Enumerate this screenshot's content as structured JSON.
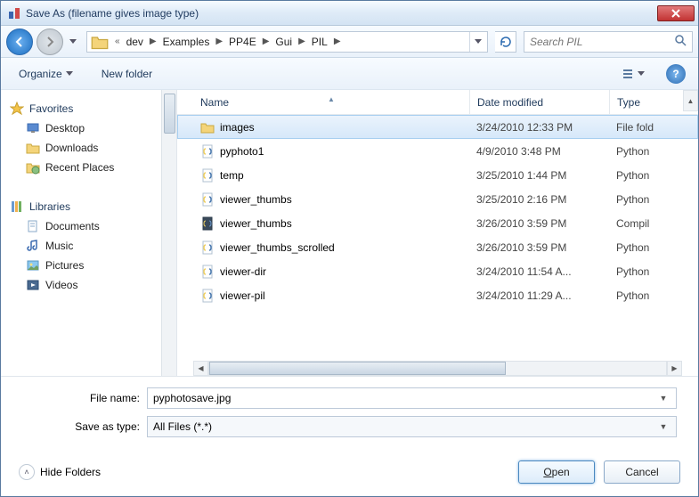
{
  "window": {
    "title": "Save As (filename gives image type)"
  },
  "breadcrumb": {
    "items": [
      "dev",
      "Examples",
      "PP4E",
      "Gui",
      "PIL"
    ]
  },
  "search": {
    "placeholder": "Search PIL"
  },
  "toolbar": {
    "organize": "Organize",
    "newfolder": "New folder"
  },
  "sidebar": {
    "fav_head": "Favorites",
    "fav_items": [
      "Desktop",
      "Downloads",
      "Recent Places"
    ],
    "lib_head": "Libraries",
    "lib_items": [
      "Documents",
      "Music",
      "Pictures",
      "Videos"
    ]
  },
  "columns": {
    "name": "Name",
    "date": "Date modified",
    "type": "Type"
  },
  "files": [
    {
      "name": "images",
      "date": "3/24/2010 12:33 PM",
      "type": "File fold",
      "icon": "folder",
      "selected": true
    },
    {
      "name": "pyphoto1",
      "date": "4/9/2010 3:48 PM",
      "type": "Python",
      "icon": "py"
    },
    {
      "name": "temp",
      "date": "3/25/2010 1:44 PM",
      "type": "Python",
      "icon": "py"
    },
    {
      "name": "viewer_thumbs",
      "date": "3/25/2010 2:16 PM",
      "type": "Python",
      "icon": "py"
    },
    {
      "name": "viewer_thumbs",
      "date": "3/26/2010 3:59 PM",
      "type": "Compil",
      "icon": "pyc"
    },
    {
      "name": "viewer_thumbs_scrolled",
      "date": "3/26/2010 3:59 PM",
      "type": "Python",
      "icon": "py"
    },
    {
      "name": "viewer-dir",
      "date": "3/24/2010 11:54 A...",
      "type": "Python",
      "icon": "py"
    },
    {
      "name": "viewer-pil",
      "date": "3/24/2010 11:29 A...",
      "type": "Python",
      "icon": "py"
    }
  ],
  "form": {
    "filename_label": "File name:",
    "filename_value": "pyphotosave.jpg",
    "savetype_label": "Save as type:",
    "savetype_value": "All Files (*.*)"
  },
  "footer": {
    "hide": "Hide Folders",
    "open": "Open",
    "cancel": "Cancel"
  }
}
